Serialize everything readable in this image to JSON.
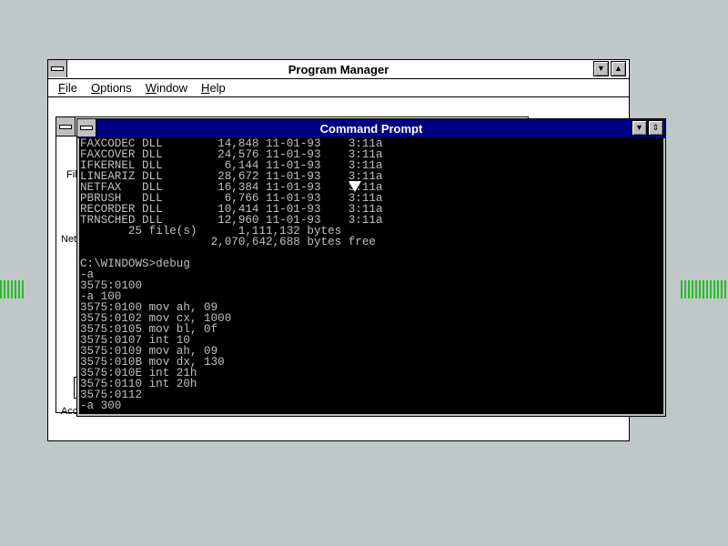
{
  "program_manager": {
    "title": "Program Manager",
    "menu": [
      "File",
      "Options",
      "Window",
      "Help"
    ]
  },
  "group_window": {
    "partial_labels": [
      "Fil",
      "Net",
      "Acc"
    ]
  },
  "command_prompt": {
    "title": "Command Prompt",
    "lines": [
      "FAXCODEC DLL        14,848 11-01-93    3:11a",
      "FAXCOVER DLL        24,576 11-01-93    3:11a",
      "IFKERNEL DLL         6,144 11-01-93    3:11a",
      "LINEARIZ DLL        28,672 11-01-93    3:11a",
      "NETFAX   DLL        16,384 11-01-93    3:11a",
      "PBRUSH   DLL         6,766 11-01-93    3:11a",
      "RECORDER DLL        10,414 11-01-93    3:11a",
      "TRNSCHED DLL        12,960 11-01-93    3:11a",
      "       25 file(s)      1,111,132 bytes",
      "                   2,070,642,688 bytes free",
      "",
      "C:\\WINDOWS>debug",
      "-a",
      "3575:0100",
      "-a 100",
      "3575:0100 mov ah, 09",
      "3575:0102 mov cx, 1000",
      "3575:0105 mov bl, 0f",
      "3575:0107 int 10",
      "3575:0109 mov ah, 09",
      "3575:010B mov dx, 130",
      "3575:010E int 21h",
      "3575:0110 int 20h",
      "3575:0112",
      "-a 300"
    ]
  }
}
